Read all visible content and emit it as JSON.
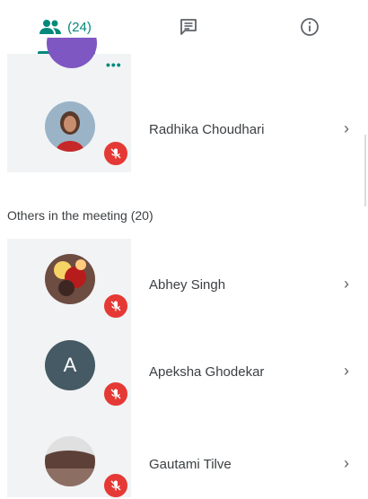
{
  "tabs": {
    "people_label": "(24)",
    "chat_icon": "chat-icon",
    "info_icon": "info-icon"
  },
  "top_participant": {
    "name": "Radhika Choudhari"
  },
  "others_section": {
    "title": "Others in the meeting (20)"
  },
  "participants": [
    {
      "name": "Abhey Singh"
    },
    {
      "name": "Apeksha Ghodekar",
      "initial": "A"
    },
    {
      "name": "Gautami Tilve"
    }
  ],
  "colors": {
    "accent": "#00897b",
    "muted": "#e53935",
    "panel": "#f1f3f4"
  }
}
